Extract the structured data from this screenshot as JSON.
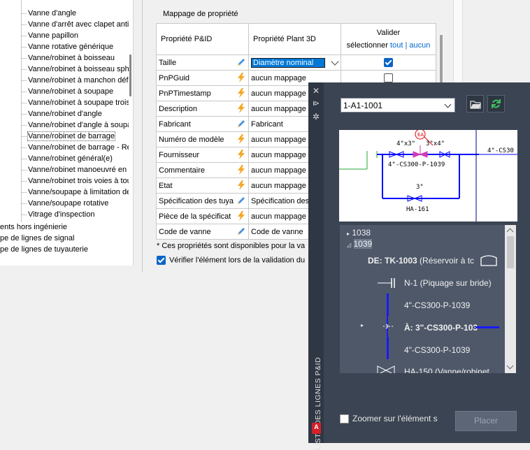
{
  "tree": {
    "items": [
      "Vanne d'angle",
      "Vanne d'arrêt avec clapet anti-",
      "Vanne papillon",
      "Vanne rotative générique",
      "Vanne/robinet à boisseau",
      "Vanne/robinet à boisseau sphé",
      "Vanne/robinet à manchon défo",
      "Vanne/robinet à soupape",
      "Vanne/robinet à soupape trois",
      "Vanne/robinet d'angle",
      "Vanne/robinet d'angle à soupa",
      "Vanne/robinet de barrage",
      "Vanne/robinet de barrage - Ré",
      "Vanne/robinet général(e)",
      "Vanne/robinet manoeuvré en c",
      "Vanne/robinet trois voies à tou",
      "Vanne/soupape à limitation de",
      "Vanne/soupape rotative",
      "Vitrage d'inspection"
    ],
    "selected_index": 11,
    "root_items": [
      "ents hors ingénierie",
      "pe de lignes de signal",
      "pe de lignes de tuyauterie"
    ]
  },
  "mapping": {
    "section_title": "Mappage de propriété",
    "col_pid": "Propriété P&ID",
    "col_plant": "Propriété Plant 3D",
    "col_validate": "Valider",
    "col_validate_select": "sélectionner",
    "link_all": "tout",
    "link_sep": "|",
    "link_none": "aucun",
    "rows": [
      {
        "pid": "Taille",
        "icon": "pencil-icon",
        "plant": "Diamètre nominal",
        "selected": true,
        "validate": true
      },
      {
        "pid": "PnPGuid",
        "icon": "lightning-icon",
        "plant": "aucun mappage",
        "validate": false
      },
      {
        "pid": "PnPTimestamp",
        "icon": "lightning-icon",
        "plant": "aucun mappage"
      },
      {
        "pid": "Description",
        "icon": "lightning-icon",
        "plant": "aucun mappage"
      },
      {
        "pid": "Fabricant",
        "icon": "pencil-icon",
        "plant": "Fabricant"
      },
      {
        "pid": "Numéro de modèle",
        "icon": "lightning-icon",
        "plant": "aucun mappage"
      },
      {
        "pid": "Fournisseur",
        "icon": "lightning-icon",
        "plant": "aucun mappage"
      },
      {
        "pid": "Commentaire",
        "icon": "lightning-icon",
        "plant": "aucun mappage"
      },
      {
        "pid": "Etat",
        "icon": "lightning-icon",
        "plant": "aucun mappage"
      },
      {
        "pid": "Spécification des tuya",
        "icon": "pencil-icon",
        "plant": "Spécification des"
      },
      {
        "pid": "Pièce de la spécificat",
        "icon": "lightning-icon",
        "plant": "aucun mappage"
      },
      {
        "pid": "Code de vanne",
        "icon": "pencil-icon",
        "plant": "Code de vanne"
      }
    ],
    "footnote": "* Ces propriétés sont disponibles pour la va",
    "verify_label": "Vérifier l'élément lors de la validation du"
  },
  "palette": {
    "title": "LISTE DES LIGNES P&ID",
    "line_number": "1-A1-1001",
    "logo": "A",
    "preview": {
      "label_4x3": "4\"x3\"",
      "label_3x4": "3\"x4\"",
      "label_line1": "4\"-CS300-P-1039",
      "label_right": "4\"-CS30",
      "label_3in": "3\"",
      "label_ha": "HA-161",
      "label_tag": "EA"
    },
    "list": {
      "group1": "1038",
      "group2": "1039",
      "from_label": "DE: TK-1003",
      "from_desc": "(Réservoir à tc",
      "nozzle": "N-1  (Piquage sur bride)",
      "pipe1": "4\"-CS300-P-1039",
      "to_label": "À: 3\"-CS300-P-103",
      "pipe2": "4\"-CS300-P-1039",
      "valve": "HA-150  (Vanne/robinet"
    },
    "zoom_label": "Zoomer sur l'élément s",
    "place_button": "Placer"
  },
  "colors": {
    "accent": "#0078d7",
    "palette_bg": "#3b4453",
    "pipe_blue": "#0000ff",
    "lightning": "#f5a623"
  }
}
